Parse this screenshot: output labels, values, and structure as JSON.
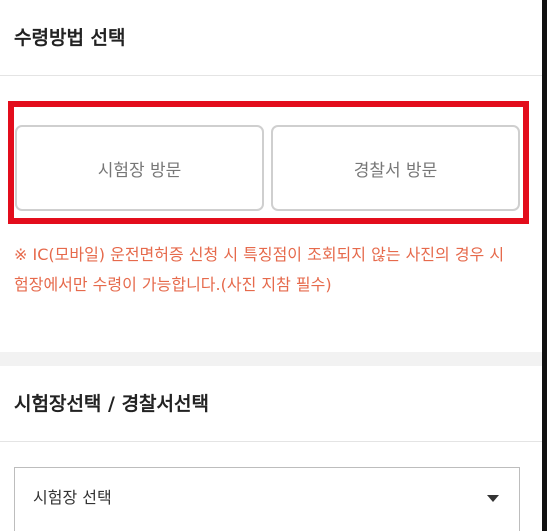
{
  "receipt_section": {
    "title": "수령방법 선택",
    "options": [
      {
        "label": "시험장 방문"
      },
      {
        "label": "경찰서 방문"
      }
    ],
    "notice": "※ IC(모바일) 운전면허증 신청 시 특징점이 조회되지 않는 사진의 경우 시험장에서만 수령이 가능합니다.(사진 지참 필수)"
  },
  "location_section": {
    "title": "시험장선택 / 경찰서선택",
    "select": {
      "selected": "시험장 선택",
      "icon": "chevron-down-icon"
    }
  },
  "colors": {
    "highlight": "#e30d1c",
    "notice": "#e66a4c"
  }
}
